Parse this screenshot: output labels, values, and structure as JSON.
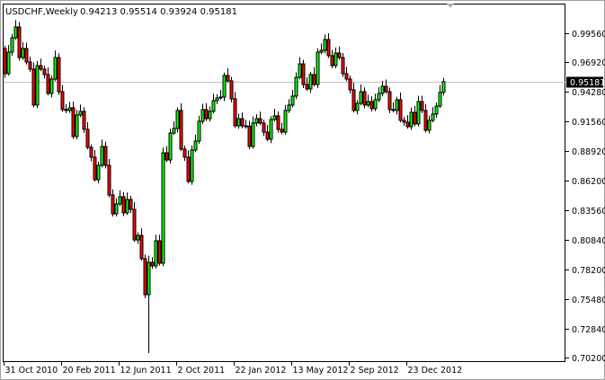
{
  "header": {
    "symbol_timeframe": "USDCHF,Weekly",
    "ohlc_readout": "0.94213 0.95514 0.93924 0.95181"
  },
  "current_price_label": "0.95181",
  "colors": {
    "bull": "#00ff00",
    "bear": "#ff0000",
    "outline": "#000000",
    "price_line": "#c0c0c0"
  },
  "chart_data": {
    "type": "candlestick",
    "title": "USDCHF,Weekly",
    "ylim": [
      0.6985,
      1.0
    ],
    "y_ticks": [
      0.9956,
      0.9692,
      0.9428,
      0.9156,
      0.8892,
      0.862,
      0.8356,
      0.8084,
      0.782,
      0.7548,
      0.7284,
      0.702
    ],
    "y_tick_labels": [
      "0.99560",
      "0.96920",
      "0.94280",
      "0.91560",
      "0.88920",
      "0.86200",
      "0.83560",
      "0.80840",
      "0.78200",
      "0.75480",
      "0.72840",
      "0.70200"
    ],
    "x_ticks": [
      {
        "index": 0,
        "label": "31 Oct 2010"
      },
      {
        "index": 16,
        "label": "20 Feb 2011"
      },
      {
        "index": 32,
        "label": "12 Jun 2011"
      },
      {
        "index": 48,
        "label": "2 Oct 2011"
      },
      {
        "index": 64,
        "label": "22 Jan 2012"
      },
      {
        "index": 80,
        "label": "13 May 2012"
      },
      {
        "index": 96,
        "label": "2 Sep 2012"
      },
      {
        "index": 112,
        "label": "23 Dec 2012"
      }
    ],
    "first_open": 0.9818,
    "close": [
      0.959,
      0.9785,
      0.9915,
      1.0013,
      0.9736,
      0.9818,
      0.9696,
      0.9631,
      0.9306,
      0.9663,
      0.9631,
      0.9582,
      0.9411,
      0.9541,
      0.9736,
      0.9427,
      0.9265,
      0.9257,
      0.9281,
      0.9021,
      0.9216,
      0.9249,
      0.9086,
      0.8923,
      0.8834,
      0.863,
      0.876,
      0.8931,
      0.876,
      0.8492,
      0.8321,
      0.8411,
      0.8476,
      0.833,
      0.8451,
      0.8362,
      0.8085,
      0.8126,
      0.7915,
      0.7589,
      0.7882,
      0.785,
      0.8077,
      0.7874,
      0.8874,
      0.8809,
      0.9053,
      0.9094,
      0.9257,
      0.8907,
      0.8834,
      0.8614,
      0.8899,
      0.898,
      0.9159,
      0.9265,
      0.9183,
      0.9249,
      0.9346,
      0.937,
      0.9379,
      0.9574,
      0.9525,
      0.9362,
      0.9118,
      0.9183,
      0.9118,
      0.9115,
      0.8931,
      0.9143,
      0.9183,
      0.9143,
      0.9061,
      0.8996,
      0.9175,
      0.9208,
      0.9086,
      0.9061,
      0.9257,
      0.9306,
      0.9387,
      0.9557,
      0.9679,
      0.9492,
      0.9452,
      0.9582,
      0.9492,
      0.9785,
      0.9801,
      0.9899,
      0.9753,
      0.9663,
      0.9777,
      0.9736,
      0.959,
      0.9541,
      0.9444,
      0.9257,
      0.9322,
      0.9427,
      0.9306,
      0.9338,
      0.9273,
      0.9354,
      0.9411,
      0.9476,
      0.9427,
      0.9265,
      0.9257,
      0.9354,
      0.9167,
      0.9151,
      0.911,
      0.924,
      0.9135,
      0.9338,
      0.9257,
      0.9078,
      0.9167,
      0.9224,
      0.9297,
      0.9421,
      0.95181
    ],
    "overrides": [
      {
        "index": 40,
        "low": 0.7061
      },
      {
        "index": 122,
        "open": 0.94213,
        "high": 0.95514,
        "low": 0.93924
      }
    ],
    "current_price": 0.95181
  }
}
